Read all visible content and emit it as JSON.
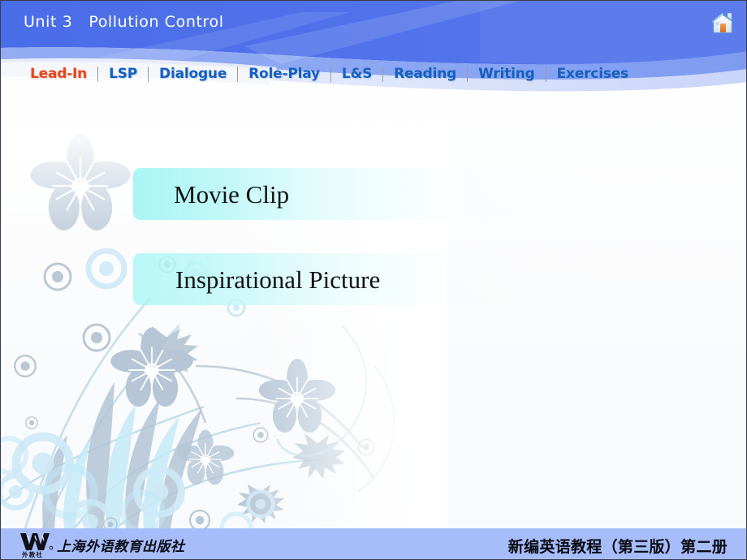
{
  "slide": {
    "unit_title": "Unit 3   Pollution Control",
    "home_icon_name": "home-icon"
  },
  "nav": {
    "items": [
      {
        "label": "Lead-In",
        "active": true
      },
      {
        "label": "LSP",
        "active": false
      },
      {
        "label": "Dialogue",
        "active": false
      },
      {
        "label": "Role-Play",
        "active": false
      },
      {
        "label": "L&S",
        "active": false
      },
      {
        "label": "Reading",
        "active": false
      },
      {
        "label": "Writing",
        "active": false
      },
      {
        "label": "Exercises",
        "active": false
      }
    ]
  },
  "main": {
    "buttons": [
      {
        "label": "Movie Clip"
      },
      {
        "label": "Inspirational Picture"
      }
    ]
  },
  "footer": {
    "publisher_cn": "上海外语教育出版社",
    "publisher_sub_cn": "外教社",
    "publisher_mark": "W",
    "book_title_cn": "新编英语教程（第三版）第二册"
  },
  "colors": {
    "header_blue": "#4a6ee8",
    "header_blue_light": "#8aa5f2",
    "header_blue_pale": "#b9c9f7",
    "nav_link": "#1460c0",
    "nav_active": "#e8441c",
    "button_cyan": "#a8f5f5",
    "footer_band": "#a6bdfa",
    "text_dark": "#121212"
  }
}
